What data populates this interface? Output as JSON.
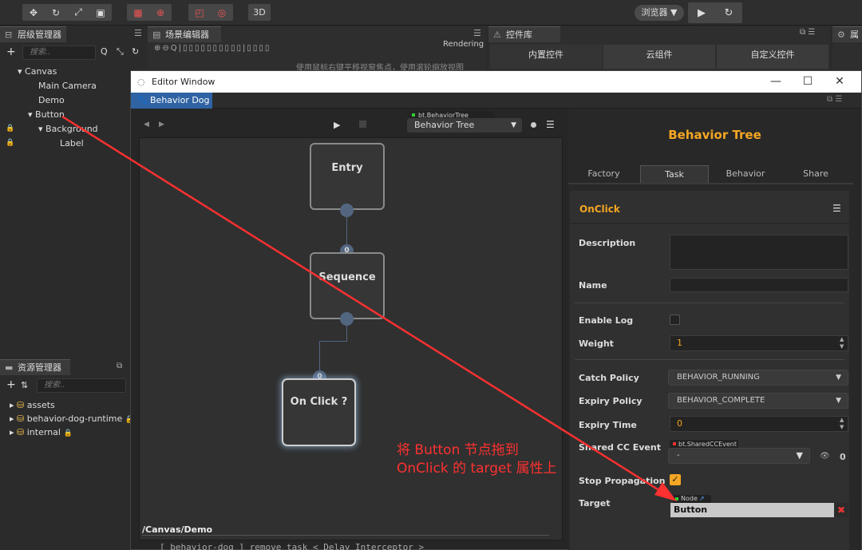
{
  "toolbar": {
    "btn_3d": "3D",
    "browser": "浏览器 ▼"
  },
  "hierarchy": {
    "title": "层级管理器",
    "search_placeholder": "搜索..",
    "nodes": [
      "Canvas",
      "Main Camera",
      "Demo",
      "Button",
      "Background",
      "Label"
    ]
  },
  "scene": {
    "title": "场景编辑器",
    "rendering": "Rendering",
    "hint": "使用鼠标右键平移视窗焦点，使用滚轮缩放视图"
  },
  "widgets": {
    "title": "控件库",
    "tabs": [
      "内置控件",
      "云组件",
      "自定义控件"
    ]
  },
  "properties": {
    "title": "属"
  },
  "assets": {
    "title": "资源管理器",
    "search_placeholder": "搜索..",
    "items": [
      "assets",
      "behavior-dog-runtime",
      "internal"
    ]
  },
  "editor_window": {
    "title": "Editor Window",
    "tab": "Behavior Dog"
  },
  "graph": {
    "tree_type_tag": "bt.BehaviorTree",
    "tree_select": "Behavior Tree",
    "path": "/Canvas/Demo",
    "nodes": {
      "entry": "Entry",
      "sequence": "Sequence",
      "onclick": "On Click ?"
    },
    "port_index": [
      "0",
      "0",
      "0"
    ]
  },
  "panel": {
    "header": "Behavior Tree",
    "tabs": [
      "Factory",
      "Task",
      "Behavior",
      "Share"
    ],
    "section": "OnClick",
    "labels": {
      "description": "Description",
      "name": "Name",
      "enable_log": "Enable Log",
      "weight": "Weight",
      "catch_policy": "Catch Policy",
      "expiry_policy": "Expiry Policy",
      "expiry_time": "Expiry Time",
      "shared_event": "Shared CC Event",
      "stop_propagation": "Stop Propagation",
      "target": "Target"
    },
    "values": {
      "weight": "1",
      "catch_policy": "BEHAVIOR_RUNNING",
      "expiry_policy": "BEHAVIOR_COMPLETE",
      "expiry_time": "0",
      "shared_event_tag": "bt.SharedCCEvent",
      "shared_event_value": "-",
      "shared_event_count": "0",
      "target_tag": "Node",
      "target_value": "Button"
    }
  },
  "annotation": {
    "line1": "将 Button 节点拖到",
    "line2": "OnClick 的 target 属性上"
  },
  "bottom_hint": "[ behavior-dog ] remove task < Delay Interceptor >",
  "colors": {
    "accent_orange": "#f5a623",
    "annotation_red": "#ff3030",
    "tab_blue": "#2f63a3"
  }
}
